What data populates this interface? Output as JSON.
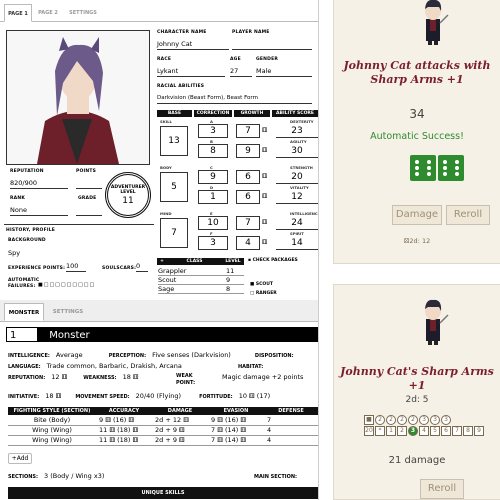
{
  "sheet_tabs": [
    "PAGE 1",
    "PAGE 2",
    "SETTINGS"
  ],
  "character": {
    "labels": {
      "name": "CHARACTER NAME",
      "player": "PLAYER NAME",
      "race": "RACE",
      "age": "AGE",
      "gender": "GENDER",
      "abilities": "RACIAL ABILITIES",
      "reputation": "REPUTATION",
      "points": "POINTS",
      "rank": "RANK",
      "grade": "GRADE",
      "adv1": "ADVENTURER",
      "adv2": "LEVEL",
      "history": "HISTORY, PROFILE",
      "background": "BACKGROUND",
      "xp": "EXPERIENCE POINTS:",
      "soulscars": "SOULSCARS:",
      "auto1": "AUTOMATIC",
      "auto2": "FAILURES:"
    },
    "name": "Johnny Cat",
    "player": "",
    "race": "Lykant",
    "age": "27",
    "gender": "Male",
    "abilities": "Darkvision (Beast Form), Beast Form",
    "reputation": "820/900",
    "points": "",
    "rank": "None",
    "grade": "",
    "level": "11",
    "background": "Spy",
    "xp": "100",
    "soulscars": "0"
  },
  "stat_headers": [
    "BASE",
    "CORRECTION",
    "GROWTH",
    "ABILITY SCORE"
  ],
  "stats": [
    {
      "group": "SKILL",
      "base": "13",
      "subs": [
        {
          "letter": "A",
          "corr": "3",
          "growth": "7",
          "name": "DEXTERITY",
          "score": "23"
        },
        {
          "letter": "B",
          "corr": "8",
          "growth": "9",
          "name": "AGILITY",
          "score": "30"
        }
      ]
    },
    {
      "group": "BODY",
      "base": "5",
      "subs": [
        {
          "letter": "C",
          "corr": "9",
          "growth": "6",
          "name": "STRENGTH",
          "score": "20"
        },
        {
          "letter": "D",
          "corr": "1",
          "growth": "6",
          "name": "VITALITY",
          "score": "12"
        }
      ]
    },
    {
      "group": "MIND",
      "base": "7",
      "subs": [
        {
          "letter": "E",
          "corr": "10",
          "growth": "7",
          "name": "INTELLIGENCE",
          "score": "24"
        },
        {
          "letter": "F",
          "corr": "3",
          "growth": "4",
          "name": "SPIRIT",
          "score": "14"
        }
      ]
    }
  ],
  "class_table": {
    "plus": "+",
    "class": "CLASS",
    "level": "LEVEL",
    "rows": [
      {
        "name": "Grappler",
        "level": "11"
      },
      {
        "name": "Scout",
        "level": "9"
      },
      {
        "name": "Sage",
        "level": "8"
      }
    ]
  },
  "packages": {
    "title": "CHECK PACKAGES",
    "rows": [
      "SCOUT",
      "RANGER"
    ]
  },
  "monster_tabs": [
    "MONSTER",
    "SETTINGS"
  ],
  "monster": {
    "level": "1",
    "name": "Monster",
    "labels": {
      "int": "INTELLIGENCE:",
      "perc": "PERCEPTION:",
      "disp": "DISPOSITION:",
      "lang": "LANGUAGE:",
      "hab": "HABITAT:",
      "rep": "REPUTATION:",
      "weak": "WEAKNESS:",
      "weakpt1": "WEAK",
      "weakpt2": "POINT:",
      "init": "INITIATIVE:",
      "move": "MOVEMENT SPEED:",
      "fort": "FORTITUDE:",
      "sections": "SECTIONS:",
      "main": "MAIN SECTION:"
    },
    "intelligence": "Average",
    "perception": "Five senses (Darkvision)",
    "language": "Trade common, Barbaric, Drakish, Arcana",
    "reputation": "12",
    "weakness": "18",
    "weakpoint": "Magic damage +2 points",
    "initiative": "18",
    "movement": "20/40 (Flying)",
    "fortitude": "10",
    "fortitude_extra": "(17)",
    "sections": "3 (Body / Wing x3)",
    "add": "+Add",
    "unique": "UNIQUE SKILLS",
    "table_headers": [
      "FIGHTING STYLE (SECTION)",
      "ACCURACY",
      "DAMAGE",
      "EVASION",
      "DEFENSE"
    ],
    "rows": [
      {
        "style": "Bite (Body)",
        "acc": "9",
        "accf": "(16)",
        "dmg": "2d + 12",
        "eva": "9",
        "evaf": "(16)",
        "def": "7"
      },
      {
        "style": "Wing (Wing)",
        "acc": "11",
        "accf": "(18)",
        "dmg": "2d + 9",
        "eva": "7",
        "evaf": "(14)",
        "def": "4"
      },
      {
        "style": "Wing (Wing)",
        "acc": "11",
        "accf": "(18)",
        "dmg": "2d + 9",
        "eva": "7",
        "evaf": "(14)",
        "def": "4"
      }
    ]
  },
  "chat": {
    "card1": {
      "title": "Johnny Cat attacks with Sharp Arms +1",
      "value": "34",
      "result": "Automatic Success!",
      "damage_btn": "Damage",
      "reroll_btn": "Reroll",
      "footer": "2d: 12",
      "dice": [
        6,
        6
      ]
    },
    "card2": {
      "title": "Johnny Cat's Sharp Arms +1",
      "roll": "2d: 5",
      "damage": "21 damage",
      "reroll_btn": "Reroll",
      "rate_top": [
        "2",
        "2",
        "2",
        "2",
        "3",
        "3",
        "3"
      ],
      "rate_bottom": [
        "20",
        "*",
        "1",
        "2",
        "3",
        "4",
        "5",
        "6",
        "7",
        "8",
        "9"
      ],
      "highlight": "3"
    }
  },
  "colors": {
    "card_bg": "#f6f1e6",
    "title": "#7b1e2c",
    "success": "#2e8b2e",
    "die": "#2e8b2e"
  }
}
